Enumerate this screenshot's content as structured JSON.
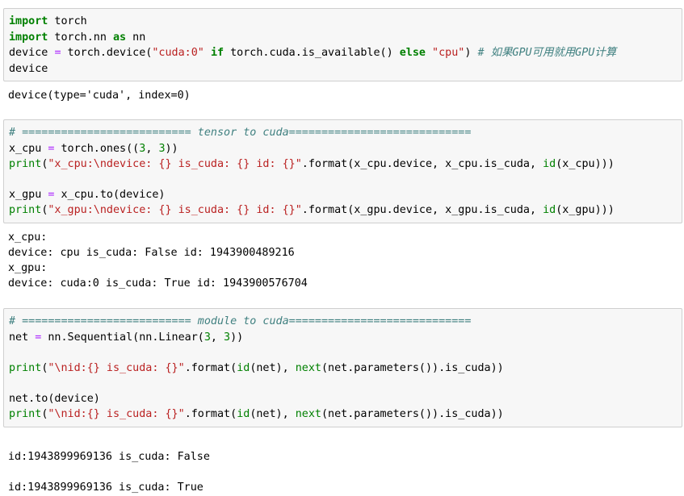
{
  "cells": [
    {
      "input": [
        [
          [
            "import",
            "k"
          ],
          [
            " torch",
            ""
          ]
        ],
        [
          [
            "import",
            "k"
          ],
          [
            " torch.nn ",
            ""
          ],
          [
            "as",
            "k"
          ],
          [
            " nn",
            ""
          ]
        ],
        [
          [
            "device ",
            ""
          ],
          [
            "=",
            "o"
          ],
          [
            " torch.device(",
            ""
          ],
          [
            "\"cuda:0\"",
            "s"
          ],
          [
            " ",
            ""
          ],
          [
            "if",
            "k"
          ],
          [
            " torch.cuda.is_available() ",
            ""
          ],
          [
            "else",
            "k"
          ],
          [
            " ",
            ""
          ],
          [
            "\"cpu\"",
            "s"
          ],
          [
            ") ",
            ""
          ],
          [
            "# 如果GPU可用就用GPU计算",
            "c"
          ]
        ],
        [
          [
            "device",
            ""
          ]
        ]
      ],
      "output": [
        "device(type='cuda', index=0)"
      ]
    },
    {
      "input": [
        [
          [
            "# ========================== tensor to cuda============================",
            "c"
          ]
        ],
        [
          [
            "x_cpu ",
            ""
          ],
          [
            "=",
            "o"
          ],
          [
            " torch.ones((",
            ""
          ],
          [
            "3",
            "n"
          ],
          [
            ", ",
            ""
          ],
          [
            "3",
            "n"
          ],
          [
            "))",
            ""
          ]
        ],
        [
          [
            "print",
            "b"
          ],
          [
            "(",
            ""
          ],
          [
            "\"x_cpu:\\ndevice: {} is_cuda: {} id: {}\"",
            "s"
          ],
          [
            ".format(x_cpu.device, x_cpu.is_cuda, ",
            ""
          ],
          [
            "id",
            "b"
          ],
          [
            "(x_cpu)))",
            ""
          ]
        ],
        [],
        [
          [
            "x_gpu ",
            ""
          ],
          [
            "=",
            "o"
          ],
          [
            " x_cpu.to(device)",
            ""
          ]
        ],
        [
          [
            "print",
            "b"
          ],
          [
            "(",
            ""
          ],
          [
            "\"x_gpu:\\ndevice: {} is_cuda: {} id: {}\"",
            "s"
          ],
          [
            ".format(x_gpu.device, x_gpu.is_cuda, ",
            ""
          ],
          [
            "id",
            "b"
          ],
          [
            "(x_gpu)))",
            ""
          ]
        ]
      ],
      "output": [
        "x_cpu:",
        "device: cpu is_cuda: False id: 1943900489216",
        "x_gpu:",
        "device: cuda:0 is_cuda: True id: 1943900576704"
      ]
    },
    {
      "input": [
        [
          [
            "# ========================== module to cuda============================",
            "c"
          ]
        ],
        [
          [
            "net ",
            ""
          ],
          [
            "=",
            "o"
          ],
          [
            " nn.Sequential(nn.Linear(",
            ""
          ],
          [
            "3",
            "n"
          ],
          [
            ", ",
            ""
          ],
          [
            "3",
            "n"
          ],
          [
            "))",
            ""
          ]
        ],
        [],
        [
          [
            "print",
            "b"
          ],
          [
            "(",
            ""
          ],
          [
            "\"\\nid:{} is_cuda: {}\"",
            "s"
          ],
          [
            ".format(",
            ""
          ],
          [
            "id",
            "b"
          ],
          [
            "(net), ",
            ""
          ],
          [
            "next",
            "b"
          ],
          [
            "(net.parameters()).is_cuda))",
            ""
          ]
        ],
        [],
        [
          [
            "net.to(device)",
            ""
          ]
        ],
        [
          [
            "print",
            "b"
          ],
          [
            "(",
            ""
          ],
          [
            "\"\\nid:{} is_cuda: {}\"",
            "s"
          ],
          [
            ".format(",
            ""
          ],
          [
            "id",
            "b"
          ],
          [
            "(net), ",
            ""
          ],
          [
            "next",
            "b"
          ],
          [
            "(net.parameters()).is_cuda))",
            ""
          ]
        ]
      ],
      "output": [
        "",
        "id:1943899969136 is_cuda: False",
        "",
        "id:1943899969136 is_cuda: True"
      ]
    }
  ]
}
